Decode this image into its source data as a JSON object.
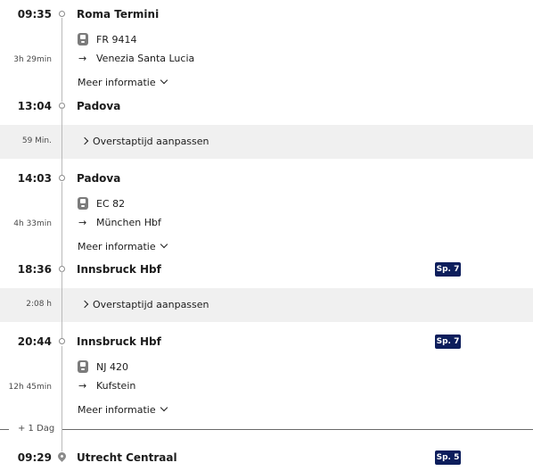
{
  "segments": [
    {
      "dep_time": "09:35",
      "dep_station": "Roma Termini",
      "duration": "3h 29min",
      "train": "FR 9414",
      "direction_arrow": "→",
      "direction": "Venezia Santa Lucia",
      "more_label": "Meer informatie",
      "arr_time": "13:04",
      "arr_station": "Padova"
    },
    {
      "dep_time": "14:03",
      "dep_station": "Padova",
      "duration": "4h 33min",
      "train": "EC 82",
      "direction_arrow": "→",
      "direction": "München Hbf",
      "more_label": "Meer informatie",
      "arr_time": "18:36",
      "arr_station": "Innsbruck Hbf",
      "arr_platform": "Sp. 7"
    },
    {
      "dep_time": "20:44",
      "dep_station": "Innsbruck Hbf",
      "dep_platform": "Sp. 7",
      "duration": "12h 45min",
      "train": "NJ 420",
      "direction_arrow": "→",
      "direction": "Kufstein",
      "more_label": "Meer informatie",
      "arr_time": "09:29",
      "arr_station": "Utrecht Centraal",
      "arr_platform": "Sp. 5"
    }
  ],
  "transfers": [
    {
      "duration": "59 Min.",
      "label": "Overstaptijd aanpassen"
    },
    {
      "duration": "2:08 h",
      "label": "Overstaptijd aanpassen"
    }
  ],
  "day_change": "+ 1 Dag",
  "icons": {
    "stop": "stop-circle-icon",
    "train": "train-icon",
    "destination": "map-pin-icon",
    "expand": "chevron-down-icon",
    "transfer": "chevron-right-icon"
  },
  "colors": {
    "platform_badge": "#0d1e5c",
    "transfer_bg": "#f0f0f0",
    "timeline": "#b9b9b9"
  }
}
